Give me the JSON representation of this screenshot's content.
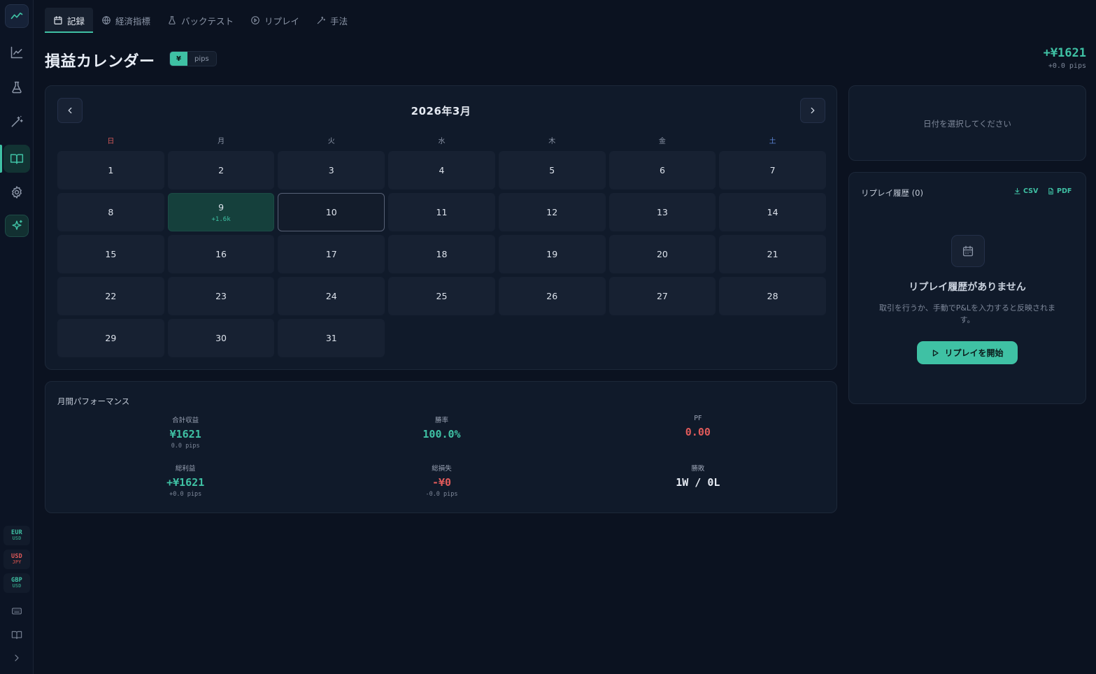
{
  "sidebar": {
    "pairs": [
      {
        "base": "EUR",
        "quote": "USD",
        "tone": "green"
      },
      {
        "base": "USD",
        "quote": "JPY",
        "tone": "red"
      },
      {
        "base": "GBP",
        "quote": "USD",
        "tone": "green"
      }
    ]
  },
  "tabs": [
    {
      "label": "記録",
      "icon": "calendar-icon",
      "active": true
    },
    {
      "label": "経済指標",
      "icon": "globe-icon"
    },
    {
      "label": "バックテスト",
      "icon": "flask-icon"
    },
    {
      "label": "リプレイ",
      "icon": "play-circle-icon"
    },
    {
      "label": "手法",
      "icon": "magic-wand-icon"
    }
  ],
  "header": {
    "title": "損益カレンダー",
    "unit_yen": "¥",
    "unit_pips": "pips",
    "total_amount": "+¥1621",
    "total_pips": "+0.0 pips"
  },
  "calendar": {
    "month_label": "2026年3月",
    "weekdays": [
      "日",
      "月",
      "火",
      "水",
      "木",
      "金",
      "土"
    ],
    "leading_blanks": 0,
    "days": [
      {
        "day": "1"
      },
      {
        "day": "2"
      },
      {
        "day": "3"
      },
      {
        "day": "4"
      },
      {
        "day": "5"
      },
      {
        "day": "6"
      },
      {
        "day": "7"
      },
      {
        "day": "8"
      },
      {
        "day": "9",
        "pl": "+1.6k",
        "state": "profit"
      },
      {
        "day": "10",
        "state": "today"
      },
      {
        "day": "11"
      },
      {
        "day": "12"
      },
      {
        "day": "13"
      },
      {
        "day": "14"
      },
      {
        "day": "15"
      },
      {
        "day": "16"
      },
      {
        "day": "17"
      },
      {
        "day": "18"
      },
      {
        "day": "19"
      },
      {
        "day": "20"
      },
      {
        "day": "21"
      },
      {
        "day": "22"
      },
      {
        "day": "23"
      },
      {
        "day": "24"
      },
      {
        "day": "25"
      },
      {
        "day": "26"
      },
      {
        "day": "27"
      },
      {
        "day": "28"
      },
      {
        "day": "29"
      },
      {
        "day": "30"
      },
      {
        "day": "31"
      }
    ]
  },
  "performance": {
    "title": "月間パフォーマンス",
    "stats": [
      {
        "label": "合計収益",
        "value": "¥1621",
        "sub": "0.0 pips",
        "tone": "green"
      },
      {
        "label": "勝率",
        "value": "100.0%",
        "sub": "",
        "tone": "green"
      },
      {
        "label": "PF",
        "value": "0.00",
        "sub": "",
        "tone": "red"
      },
      {
        "label": "総利益",
        "value": "+¥1621",
        "sub": "+0.0 pips",
        "tone": "green"
      },
      {
        "label": "総損失",
        "value": "-¥0",
        "sub": "-0.0 pips",
        "tone": "red"
      },
      {
        "label": "勝敗",
        "value": "1W / 0L",
        "sub": "",
        "tone": "white"
      }
    ]
  },
  "date_panel": {
    "placeholder": "日付を選択してください"
  },
  "replay": {
    "title": "リプレイ履歴 (0)",
    "csv_label": "CSV",
    "pdf_label": "PDF",
    "empty_title": "リプレイ履歴がありません",
    "empty_desc": "取引を行うか、手動でP&Lを入力すると反映されます。",
    "start_label": "リプレイを開始"
  },
  "colors": {
    "accent": "#3fc1a4",
    "negative": "#e05a5a",
    "background": "#0b1220",
    "card": "#101a2a"
  }
}
